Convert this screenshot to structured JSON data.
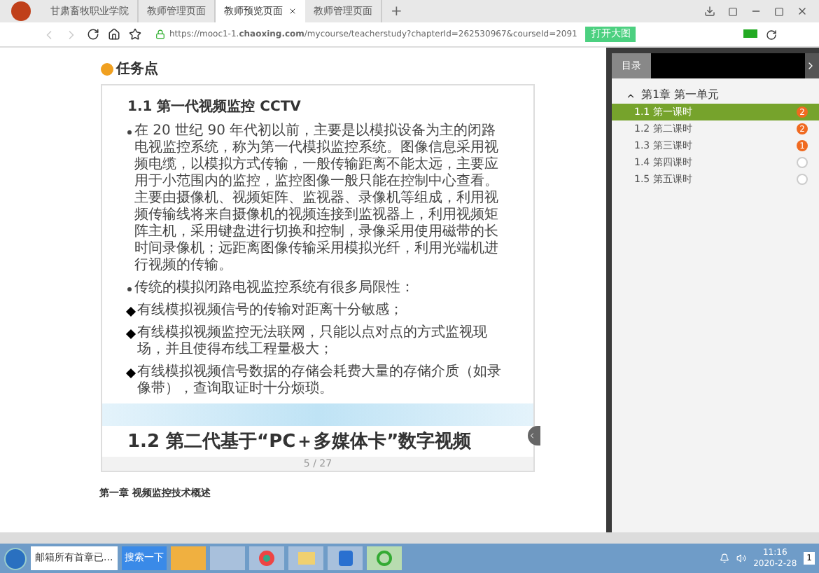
{
  "browser": {
    "tabs": [
      {
        "label": "甘肃畜牧职业学院",
        "selected": false
      },
      {
        "label": "教师管理页面",
        "selected": false
      },
      {
        "label": "教师预览页面",
        "selected": true
      },
      {
        "label": "教师管理页面",
        "selected": false
      }
    ],
    "new_tab": "+",
    "url": "https://mooc1-1.**chaoxing.com**/mycourse/teacherstudy?chapterId=262530967&courseId=2091",
    "big_image_button": "打开大图"
  },
  "content": {
    "section_title": "任务点",
    "slide": {
      "heading": "1.1 第一代视频监控 CCTV",
      "paragraphs": [
        {
          "kind": "bullet",
          "text": "在 20 世纪 90 年代初以前，主要是以模拟设备为主的闭路电视监控系统，称为第一代模拟监控系统。图像信息采用视频电缆，以模拟方式传输，一般传输距离不能太远，主要应用于小范围内的监控，监控图像一般只能在控制中心查看。主要由摄像机、视频矩阵、监视器、录像机等组成，利用视频传输线将来自摄像机的视频连接到监视器上，利用视频矩阵主机，采用键盘进行切换和控制，录像采用使用磁带的长时间录像机；远距离图像传输采用模拟光纤，利用光端机进行视频的传输。"
        },
        {
          "kind": "bullet",
          "text": "传统的模拟闭路电视监控系统有很多局限性："
        },
        {
          "kind": "diamond",
          "text": "有线模拟视频信号的传输对距离十分敏感；"
        },
        {
          "kind": "diamond",
          "text": "有线模拟视频监控无法联网，只能以点对点的方式监视现场，并且使得布线工程量极大；"
        },
        {
          "kind": "diamond",
          "text": "有线模拟视频信号数据的存储会耗费大量的存储介质（如录像带），查询取证时十分烦琐。"
        }
      ],
      "next_heading": "1.2  第二代基于“PC＋多媒体卡”数字视频",
      "page": "5 / 27"
    },
    "chapter_title": "第一章 视频监控技术概述"
  },
  "sidebar": {
    "tab": "目录",
    "chapter": {
      "label": "第1章 第一单元",
      "expanded": true,
      "children": [
        {
          "label": "1.1 第一课时",
          "selected": true,
          "badge": "2"
        },
        {
          "label": "1.2 第二课时",
          "selected": false,
          "badge": "2"
        },
        {
          "label": "1.3 第三课时",
          "selected": false,
          "badge": "1"
        },
        {
          "label": "1.4 第四课时",
          "selected": false
        },
        {
          "label": "1.5 第五课时",
          "selected": false
        }
      ]
    }
  },
  "taskbar": {
    "window": "邮箱所有首章已...",
    "search_button": "搜索一下",
    "time": "11:16",
    "date": "2020-2-28",
    "notification_count": "1"
  }
}
